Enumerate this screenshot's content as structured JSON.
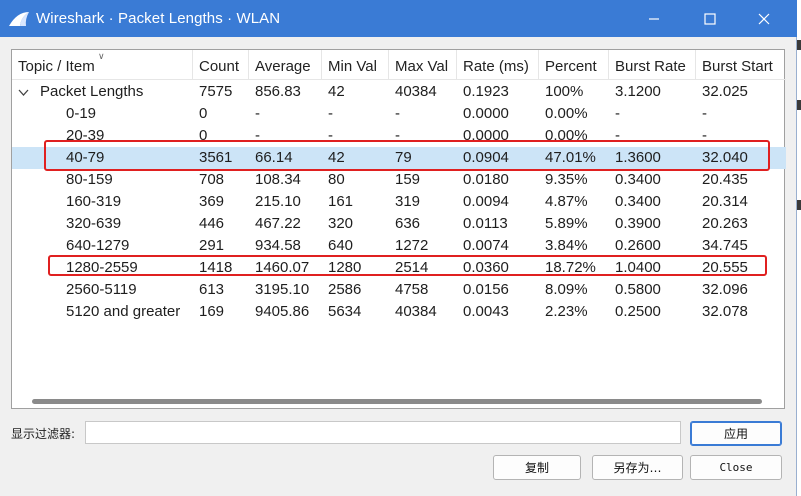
{
  "window": {
    "title": "Wireshark · Packet Lengths · WLAN",
    "accent": "#3a7bd5",
    "min_icon": "minimize-icon",
    "max_icon": "maximize-icon",
    "close_icon": "close-icon"
  },
  "table": {
    "columns": [
      "Topic / Item",
      "Count",
      "Average",
      "Min Val",
      "Max Val",
      "Rate (ms)",
      "Percent",
      "Burst Rate",
      "Burst Start"
    ],
    "rows": [
      {
        "item": "Packet Lengths",
        "count": "7575",
        "average": "856.83",
        "min": "42",
        "max": "40384",
        "rate": "0.1923",
        "percent": "100%",
        "burst_rate": "3.1200",
        "burst_start": "32.025"
      },
      {
        "item": "0-19",
        "count": "0",
        "average": "-",
        "min": "-",
        "max": "-",
        "rate": "0.0000",
        "percent": "0.00%",
        "burst_rate": "-",
        "burst_start": "-"
      },
      {
        "item": "20-39",
        "count": "0",
        "average": "-",
        "min": "-",
        "max": "-",
        "rate": "0.0000",
        "percent": "0.00%",
        "burst_rate": "-",
        "burst_start": "-"
      },
      {
        "item": "40-79",
        "count": "3561",
        "average": "66.14",
        "min": "42",
        "max": "79",
        "rate": "0.0904",
        "percent": "47.01%",
        "burst_rate": "1.3600",
        "burst_start": "32.040"
      },
      {
        "item": "80-159",
        "count": "708",
        "average": "108.34",
        "min": "80",
        "max": "159",
        "rate": "0.0180",
        "percent": "9.35%",
        "burst_rate": "0.3400",
        "burst_start": "20.435"
      },
      {
        "item": "160-319",
        "count": "369",
        "average": "215.10",
        "min": "161",
        "max": "319",
        "rate": "0.0094",
        "percent": "4.87%",
        "burst_rate": "0.3400",
        "burst_start": "20.314"
      },
      {
        "item": "320-639",
        "count": "446",
        "average": "467.22",
        "min": "320",
        "max": "636",
        "rate": "0.0113",
        "percent": "5.89%",
        "burst_rate": "0.3900",
        "burst_start": "20.263"
      },
      {
        "item": "640-1279",
        "count": "291",
        "average": "934.58",
        "min": "640",
        "max": "1272",
        "rate": "0.0074",
        "percent": "3.84%",
        "burst_rate": "0.2600",
        "burst_start": "34.745"
      },
      {
        "item": "1280-2559",
        "count": "1418",
        "average": "1460.07",
        "min": "1280",
        "max": "2514",
        "rate": "0.0360",
        "percent": "18.72%",
        "burst_rate": "1.0400",
        "burst_start": "20.555"
      },
      {
        "item": "2560-5119",
        "count": "613",
        "average": "3195.10",
        "min": "2586",
        "max": "4758",
        "rate": "0.0156",
        "percent": "8.09%",
        "burst_rate": "0.5800",
        "burst_start": "32.096"
      },
      {
        "item": "5120 and greater",
        "count": "169",
        "average": "9405.86",
        "min": "5634",
        "max": "40384",
        "rate": "0.0043",
        "percent": "2.23%",
        "burst_rate": "0.2500",
        "burst_start": "32.078"
      }
    ],
    "selected_row": "40-79",
    "highlighted_rows": [
      "40-79",
      "1280-2559"
    ],
    "highlight_color": "#e02020",
    "selection_color": "#cce4f7"
  },
  "footer": {
    "filter_label": "显示过滤器:",
    "filter_value": "",
    "apply_label": "应用",
    "copy_label": "复制",
    "save_as_label": "另存为…",
    "close_label": "Close"
  }
}
